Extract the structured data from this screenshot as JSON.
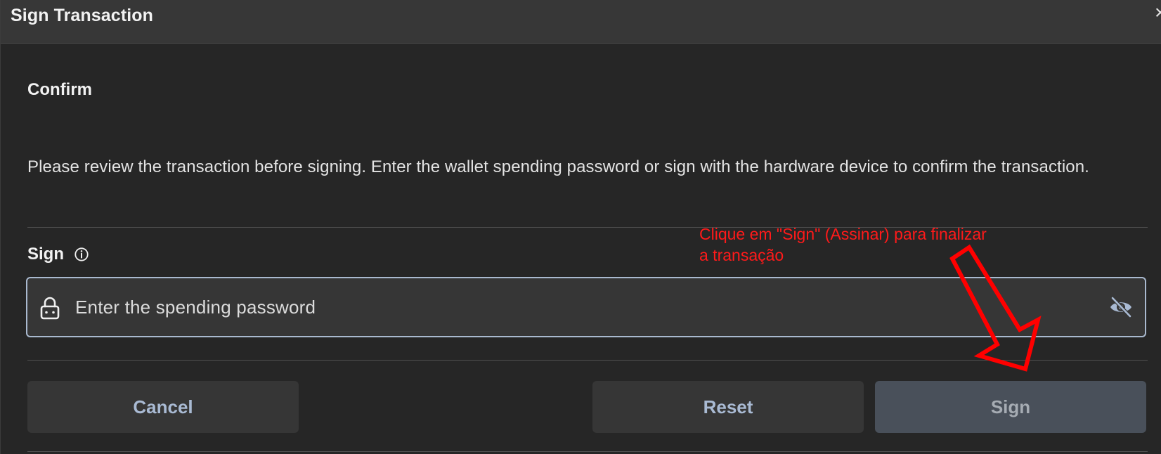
{
  "dialog": {
    "title": "Sign Transaction",
    "close_glyph": "×"
  },
  "confirm": {
    "heading": "Confirm",
    "description": "Please review the transaction before signing. Enter the wallet spending password or sign with the hardware device to confirm the transaction."
  },
  "sign": {
    "label": "Sign",
    "password_placeholder": "Enter the spending password",
    "password_value": ""
  },
  "buttons": {
    "cancel_label": "Cancel",
    "reset_label": "Reset",
    "sign_label": "Sign"
  },
  "annotation": {
    "text": "Clique em \"Sign\" (Assinar) para finalizar a transação",
    "color": "#ff0000"
  },
  "icons": {
    "close": "close-icon",
    "info": "info-icon",
    "lock": "lock-icon",
    "visibility": "eye-off-icon"
  },
  "colors": {
    "background": "#262626",
    "titlebar": "#373737",
    "field_border": "#a9b9cf",
    "button_text": "#a9bad3",
    "sign_button_bg": "#49505a"
  }
}
